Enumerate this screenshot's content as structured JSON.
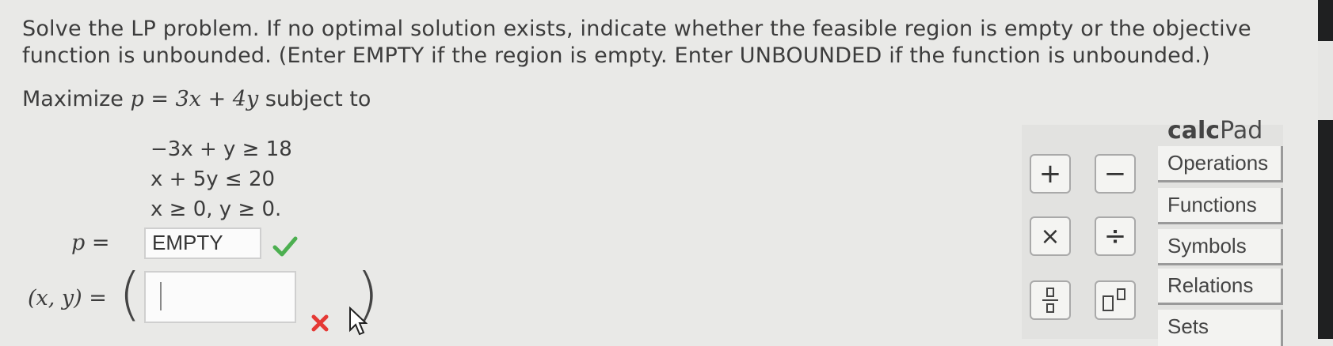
{
  "problem": {
    "instructions": "Solve the LP problem. If no optimal solution exists, indicate whether the feasible region is empty or the objective function is unbounded. (Enter EMPTY if the region is empty. Enter UNBOUNDED if the function is unbounded.)",
    "objective_prefix": "Maximize",
    "objective_expr": "p = 3x + 4y",
    "objective_suffix": "subject to",
    "constraints": [
      "−3x + y ≥ 18",
      "x + 5y ≤ 20",
      "x ≥ 0, y ≥ 0."
    ]
  },
  "answers": {
    "p_label": "p =",
    "p_value": "EMPTY",
    "p_status": "correct",
    "xy_label": "(x, y) =",
    "xy_value": "",
    "xy_status": "incorrect"
  },
  "calcpad": {
    "title_bold": "calc",
    "title_rest": "Pad",
    "buttons": [
      "+",
      "−",
      "×",
      "÷",
      "fraction",
      "exponent"
    ],
    "tabs": [
      "Operations",
      "Functions",
      "Symbols",
      "Relations",
      "Sets"
    ]
  },
  "colors": {
    "check": "#4caf50",
    "xmark": "#e53935",
    "background": "#e9e9e7"
  }
}
